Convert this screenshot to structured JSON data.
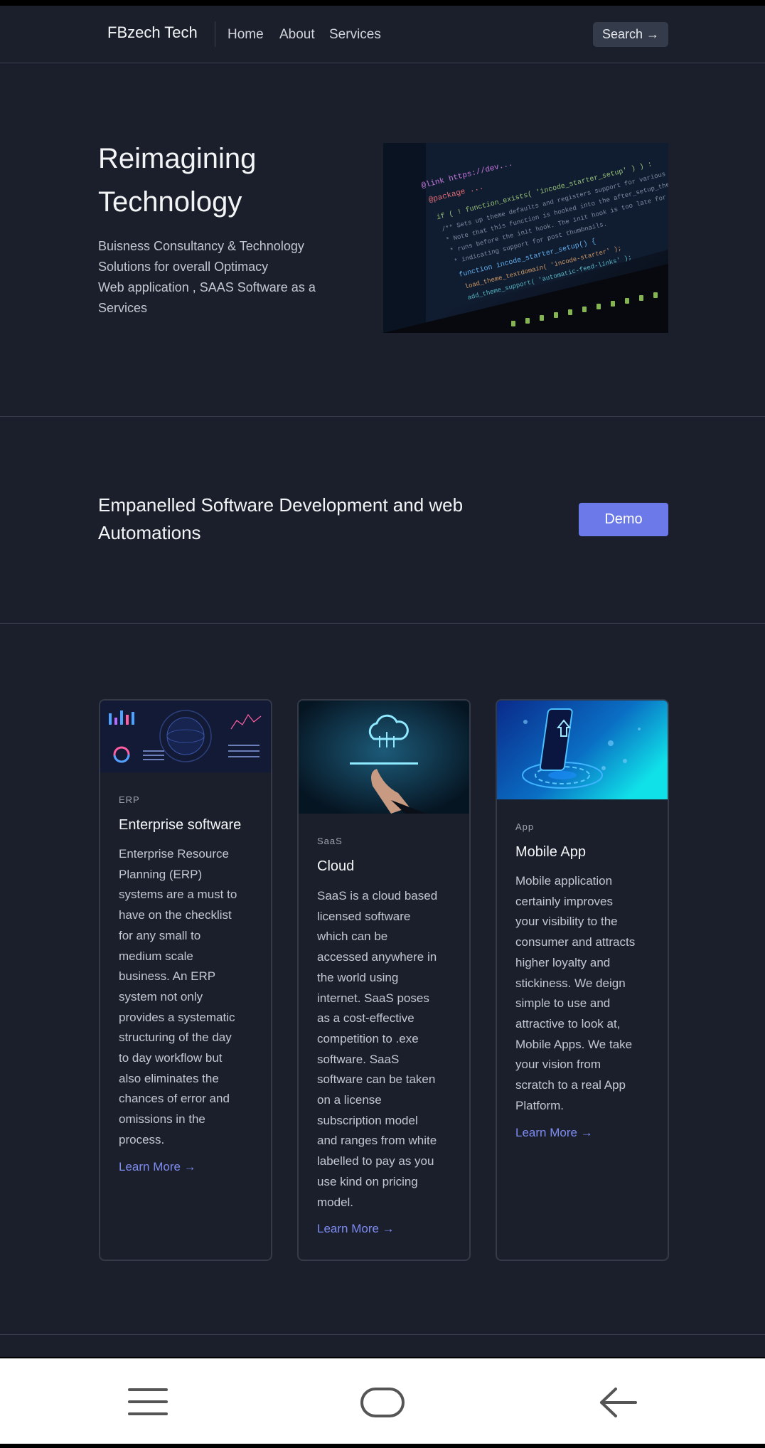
{
  "nav": {
    "brand": "FBzech Tech",
    "links": [
      "Home",
      "About",
      "Services"
    ],
    "search_label": "Search →"
  },
  "hero": {
    "title_line1": "Reimagining",
    "title_line2": "Technology",
    "desc_line1": "Buisness Consultancy & Technology",
    "desc_line2": "Solutions for overall Optimacy",
    "desc_line3": "Web application , SAAS Software as a",
    "desc_line4": "Services"
  },
  "cta": {
    "text": "Empanelled Software Development and web Automations",
    "button_label": "Demo"
  },
  "cards": [
    {
      "tag": "ERP",
      "title": "Enterprise software",
      "lines": [
        "Enterprise Resource",
        "Planning (ERP)",
        "systems are a must to",
        "have on the checklist",
        "for any small to",
        "medium scale",
        "business. An ERP",
        "system not only",
        "provides a systematic",
        "structuring of the day",
        "to day workflow but",
        "also eliminates the",
        "chances of error and",
        "omissions in the",
        "process."
      ],
      "link": "Learn More →"
    },
    {
      "tag": "SaaS",
      "title": "Cloud",
      "lines": [
        "SaaS is a cloud based",
        "licensed software",
        "which can be",
        "accessed anywhere in",
        "the world using",
        "internet. SaaS poses",
        "as a cost-effective",
        "competition to .exe",
        "software. SaaS",
        "software can be taken",
        "on a license",
        "subscription model",
        "and ranges from white",
        "labelled to pay as you",
        "use kind on pricing",
        "model."
      ],
      "link": "Learn More →"
    },
    {
      "tag": "App",
      "title": "Mobile App",
      "lines": [
        "Mobile application",
        "certainly improves",
        "your visibility to the",
        "consumer and attracts",
        "higher loyalty and",
        "stickiness. We deign",
        "simple to use and",
        "attractive to look at,",
        "Mobile Apps. We take",
        "your vision from",
        "scratch to a real App",
        "Platform."
      ],
      "link": "Learn More →"
    }
  ],
  "code_snippet": [
    "@link https://dev...",
    "@package ...",
    "if ( ! function_exists( 'incode_starter_setup' ) ) :",
    "/** Sets up theme defaults and registers support for various WordPress",
    " * Note that this function is hooked into the after_setup_theme hook",
    " * runs before the init hook. The init hook is too late for some fea",
    " * indicating support for post thumbnails.",
    "function incode_starter_setup() {",
    "   load_theme_textdomain( 'incode-starter' );",
    "   add_theme_support( 'automatic-feed-links' );"
  ],
  "colors": {
    "background": "#1b1f2b",
    "accent": "#6b7ae8",
    "link": "#7d8cf0"
  },
  "system_nav": {
    "icons": [
      "menu-icon",
      "home-icon",
      "back-icon"
    ]
  }
}
